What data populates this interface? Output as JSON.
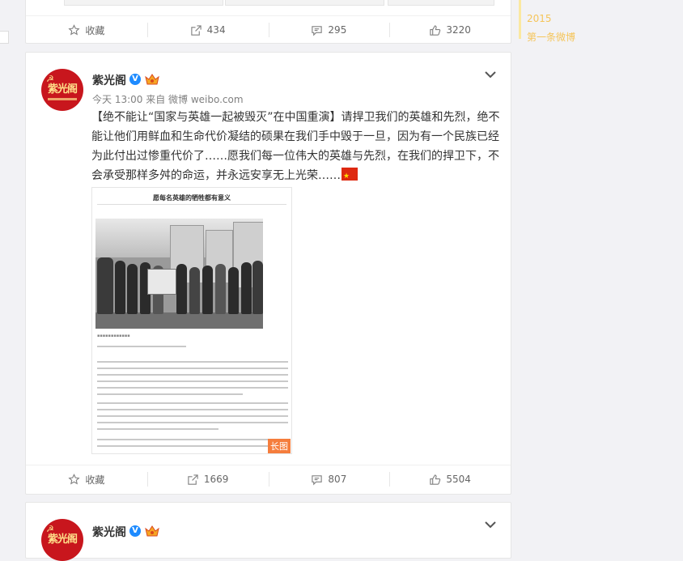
{
  "top_post": {
    "actions": {
      "favorite": "收藏",
      "repost": "434",
      "comment": "295",
      "like": "3220"
    }
  },
  "main_post": {
    "username": "紫光阁",
    "meta": "今天 13:00 来自 微博 weibo.com",
    "text": "【绝不能让“国家与英雄一起被毁灭”在中国重演】请捍卫我们的英雄和先烈，绝不能让他们用鲜血和生命代价凝结的硕果在我们手中毁于一旦，因为有一个民族已经为此付出过惨重代价了……愿我们每一位伟大的英雄与先烈，在我们的捍卫下，不会承受那样多舛的命运，并永远安享无上光荣……",
    "image": {
      "title": "愿每名英雄的牺牲都有意义",
      "badge": "长图"
    },
    "actions": {
      "favorite": "收藏",
      "repost": "1669",
      "comment": "807",
      "like": "5504"
    }
  },
  "bottom_post": {
    "username": "紫光阁"
  },
  "timeline": {
    "year": "2015",
    "first_post": "第一条微博"
  },
  "colors": {
    "accent": "#f57d3c",
    "verified": "#1e8bff",
    "timeline": "#f5c55a"
  }
}
